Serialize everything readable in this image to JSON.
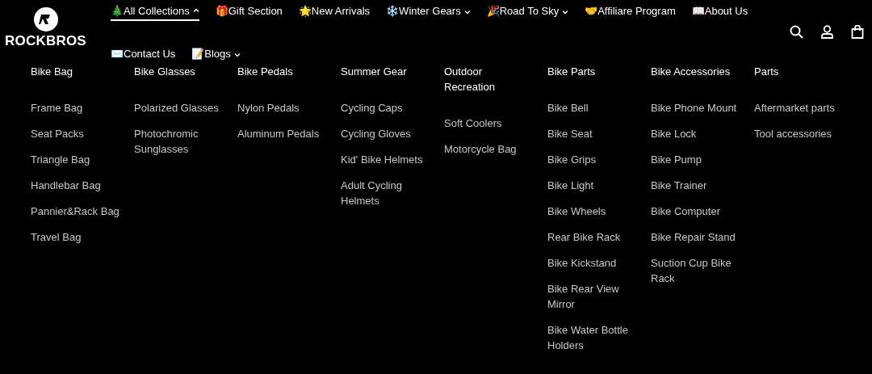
{
  "logo": {
    "text": "ROCKBROS"
  },
  "nav": [
    {
      "emoji": "🎄",
      "label": "All Collections",
      "kind": "dropdown",
      "expanded": true,
      "selected": true
    },
    {
      "emoji": "🎁",
      "label": "Gift Section",
      "kind": "link",
      "selected": false
    },
    {
      "emoji": "🌟",
      "label": "New Arrivals",
      "kind": "link",
      "selected": false
    },
    {
      "emoji": "❄️",
      "label": "Winter Gears",
      "kind": "dropdown",
      "expanded": false,
      "selected": false
    },
    {
      "emoji": "🎉",
      "label": "Road To Sky",
      "kind": "dropdown",
      "expanded": false,
      "selected": false
    },
    {
      "emoji": "🤝",
      "label": "Affiliare Program",
      "kind": "link",
      "selected": false
    },
    {
      "emoji": "📖",
      "label": "About Us",
      "kind": "link",
      "selected": false
    },
    {
      "emoji": "✉️",
      "label": "Contact Us",
      "kind": "link",
      "selected": false
    },
    {
      "emoji": "📝",
      "label": "Blogs",
      "kind": "dropdown",
      "expanded": false,
      "selected": false
    }
  ],
  "menu": [
    {
      "heading": "Bike Bag",
      "items": [
        "Frame Bag",
        "Seat Packs",
        "Triangle Bag",
        "Handlebar Bag",
        "Pannier&Rack Bag",
        "Travel Bag"
      ]
    },
    {
      "heading": "Bike Glasses",
      "items": [
        "Polarized Glasses",
        "Photochromic Sunglasses"
      ]
    },
    {
      "heading": "Bike Pedals",
      "items": [
        "Nylon Pedals",
        "Aluminum Pedals"
      ]
    },
    {
      "heading": "Summer Gear",
      "items": [
        "Cycling Caps",
        "Cycling Gloves",
        "Kid' Bike Helmets",
        "Adult Cycling Helmets"
      ]
    },
    {
      "heading": "Outdoor Recreation",
      "items": [
        "Soft Coolers",
        "Motorcycle Bag"
      ]
    },
    {
      "heading": "Bike Parts",
      "items": [
        "Bike Bell",
        "Bike Seat",
        "Bike Grips",
        "Bike Light",
        "Bike Wheels",
        "Rear Bike Rack",
        "Bike Kickstand",
        "Bike Rear View Mirror",
        "Bike Water Bottle Holders"
      ]
    },
    {
      "heading": "Bike Accessories",
      "items": [
        "Bike Phone Mount",
        "Bike Lock",
        "Bike Pump",
        "Bike Trainer",
        "Bike Computer",
        "Bike Repair Stand",
        "Suction Cup Bike Rack"
      ]
    },
    {
      "heading": "Parts",
      "items": [
        "Aftermarket parts",
        "Tool accessories"
      ]
    }
  ]
}
